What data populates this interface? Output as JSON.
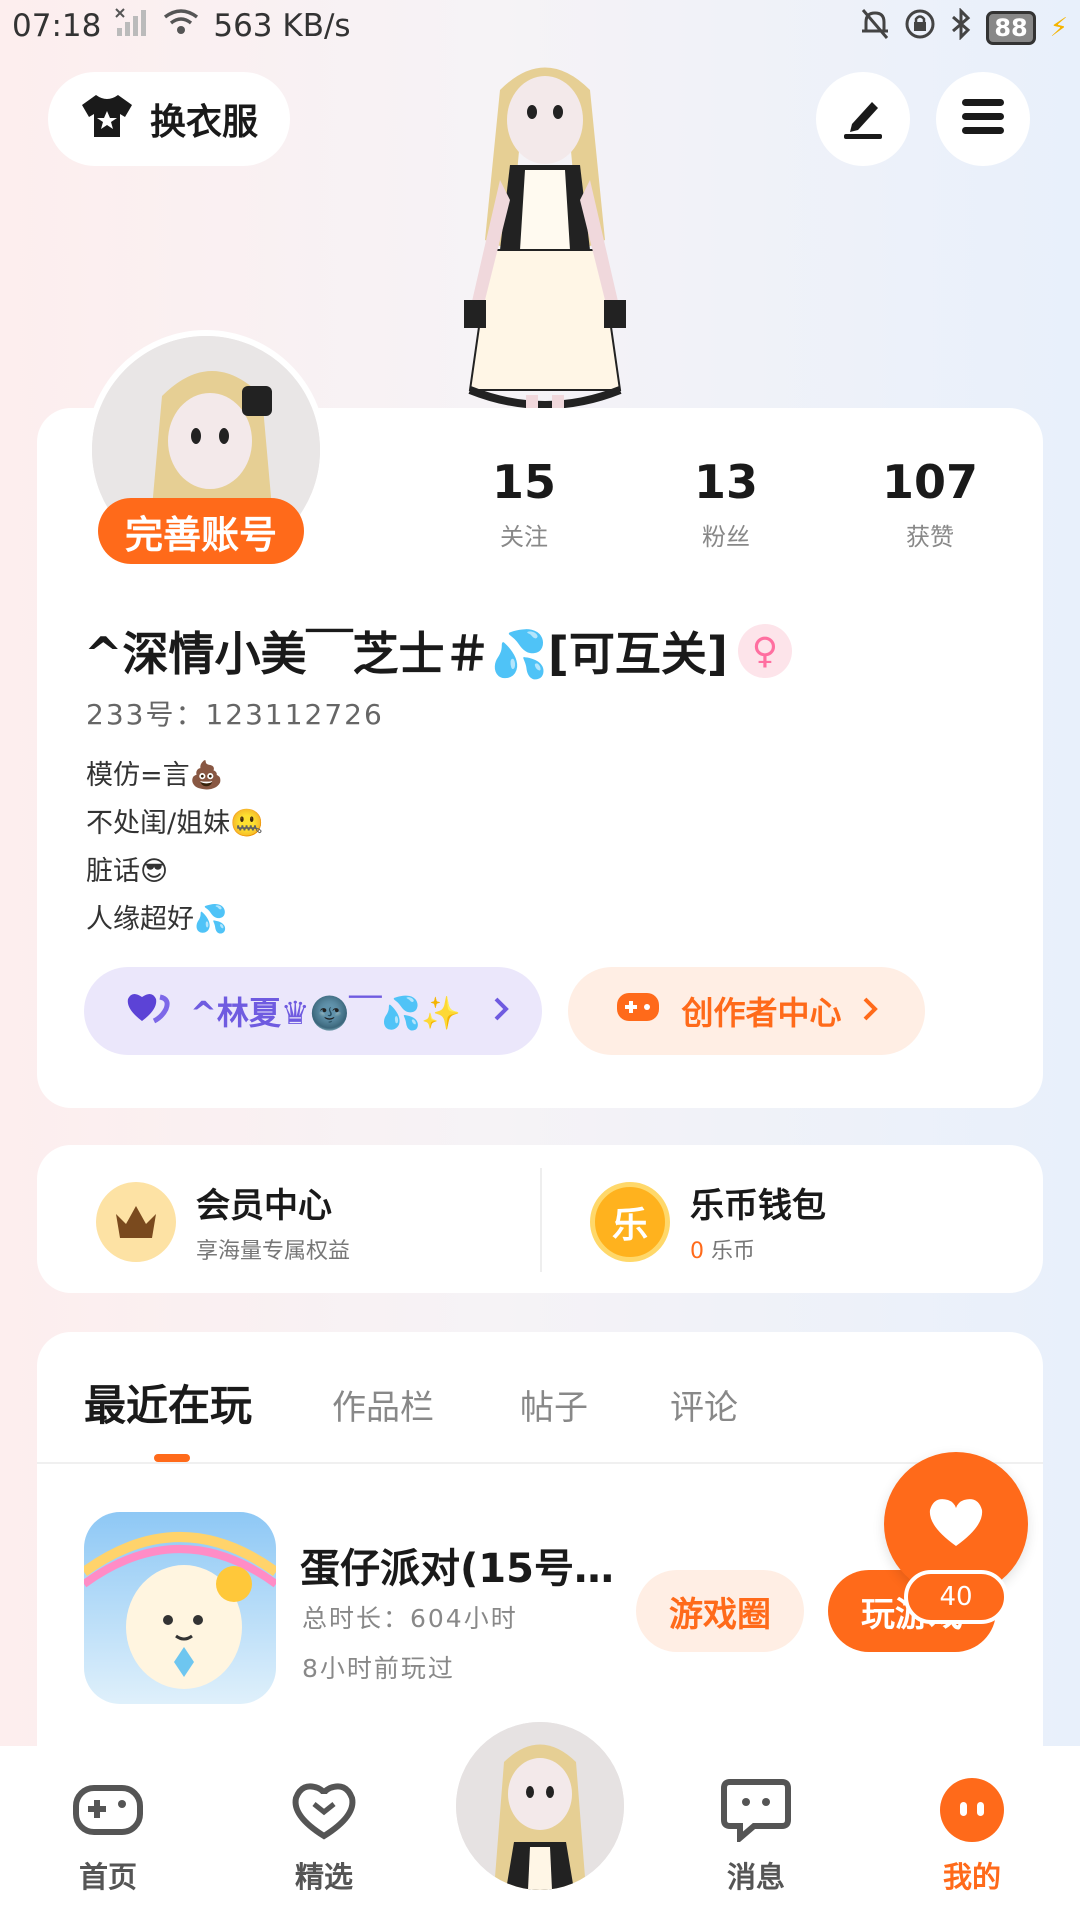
{
  "status_bar": {
    "time": "07:18",
    "speed": "563 KB/s",
    "battery": "88"
  },
  "top": {
    "outfit_label": "换衣服"
  },
  "profile": {
    "complete_label": "完善账号",
    "stats": [
      {
        "value": "15",
        "label": "关注"
      },
      {
        "value": "13",
        "label": "粉丝"
      },
      {
        "value": "107",
        "label": "获赞"
      }
    ],
    "nickname": "^深情小美￣芝士＃💦[可互关]",
    "gender_symbol": "♀",
    "uid": "233号：123112726",
    "bio": [
      "模仿=言💩",
      "不处闺/姐妹🤐",
      "脏话😎",
      "人缘超好💦"
    ],
    "friend_label": "^林夏♛🌚￣💦✨",
    "creator_label": "创作者中心"
  },
  "membership": {
    "vip_title": "会员中心",
    "vip_sub": "享海量专属权益",
    "wallet_title": "乐币钱包",
    "wallet_amount": "0",
    "wallet_unit": "乐币",
    "coin_char": "乐"
  },
  "tabs": [
    "最近在玩",
    "作品栏",
    "帖子",
    "评论"
  ],
  "recent_game": {
    "title": "蛋仔派对(15号…",
    "duration": "总时长：604小时",
    "last_played": "8小时前玩过",
    "circle_label": "游戏圈",
    "play_label": "玩游戏",
    "likes": "40"
  },
  "nav": {
    "home": "首页",
    "featured": "精选",
    "messages": "消息",
    "mine": "我的"
  },
  "colors": {
    "accent": "#ff6a1a",
    "friend_purple": "#6f5be0"
  }
}
